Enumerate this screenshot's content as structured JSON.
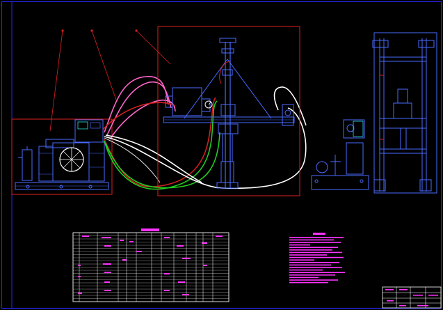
{
  "drawing": {
    "colors": {
      "background": "#000000",
      "border": "#2a2aff",
      "equipment": "#4a6bff",
      "frame_red": "#e02020",
      "hose_magenta": "#ff66cc",
      "hose_red": "#d02020",
      "hose_green": "#22cc22",
      "hose_white": "#ffffff",
      "text_magenta": "#ff33ff",
      "cyan": "#33ffff"
    },
    "callouts": [
      "",
      "",
      ""
    ],
    "parts_table": {
      "title": "",
      "rows": []
    },
    "notes": {
      "title": "",
      "lines": []
    },
    "title_block": {
      "cells": []
    }
  }
}
